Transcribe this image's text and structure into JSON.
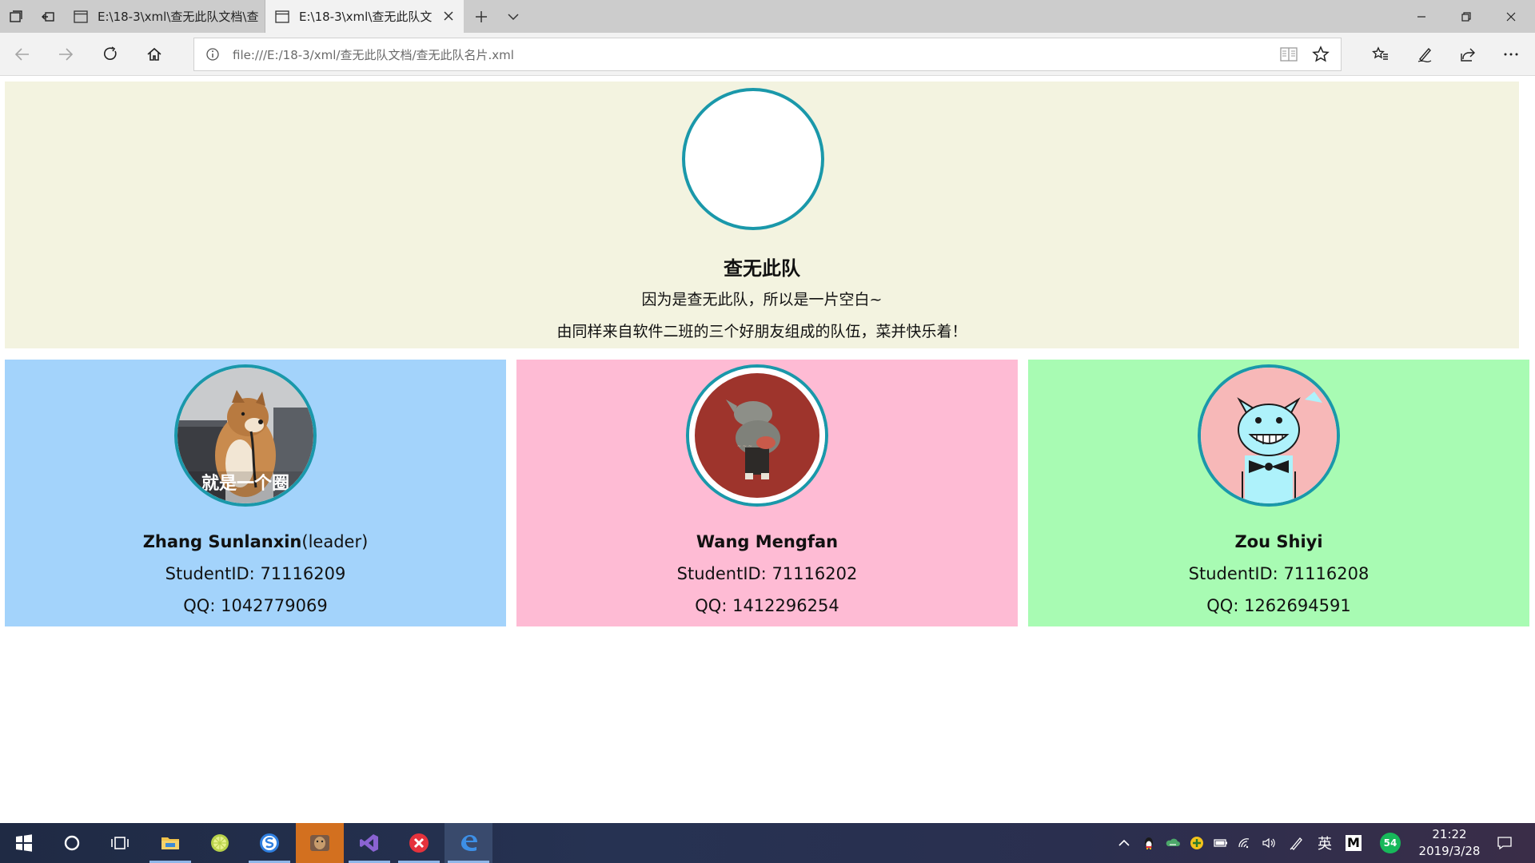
{
  "browser": {
    "tabs": [
      {
        "title": "E:\\18-3\\xml\\查无此队文档\\查",
        "active": false
      },
      {
        "title": "E:\\18-3\\xml\\查无此队文",
        "active": true
      }
    ],
    "url": "file:///E:/18-3/xml/查无此队文档/查无此队名片.xml"
  },
  "team": {
    "name": "查无此队",
    "desc_line1": "因为是查无此队，所以是一片空白~",
    "desc_line2": "由同样来自软件二班的三个好朋友组成的队伍，菜并快乐着！"
  },
  "members": [
    {
      "name": "Zhang Sunlanxin",
      "role": "(leader)",
      "student_id": "StudentID: 71116209",
      "qq": "QQ: 1042779069",
      "bg": "#a3d3fb",
      "avatar_caption": "就是一个圈"
    },
    {
      "name": "Wang Mengfan",
      "role": "",
      "student_id": "StudentID: 71116202",
      "qq": "QQ: 1412296254",
      "bg": "#febbd4"
    },
    {
      "name": "Zou Shiyi",
      "role": "",
      "student_id": "StudentID: 71116208",
      "qq": "QQ: 1262694591",
      "bg": "#a8fbb3"
    }
  ],
  "colors": {
    "ring": "#1a98aa",
    "hero_bg": "#f3f3e0"
  },
  "taskbar": {
    "clock_time": "21:22",
    "clock_date": "2019/3/28",
    "ime_label": "英",
    "m_label": "M",
    "badge_count": "54"
  }
}
